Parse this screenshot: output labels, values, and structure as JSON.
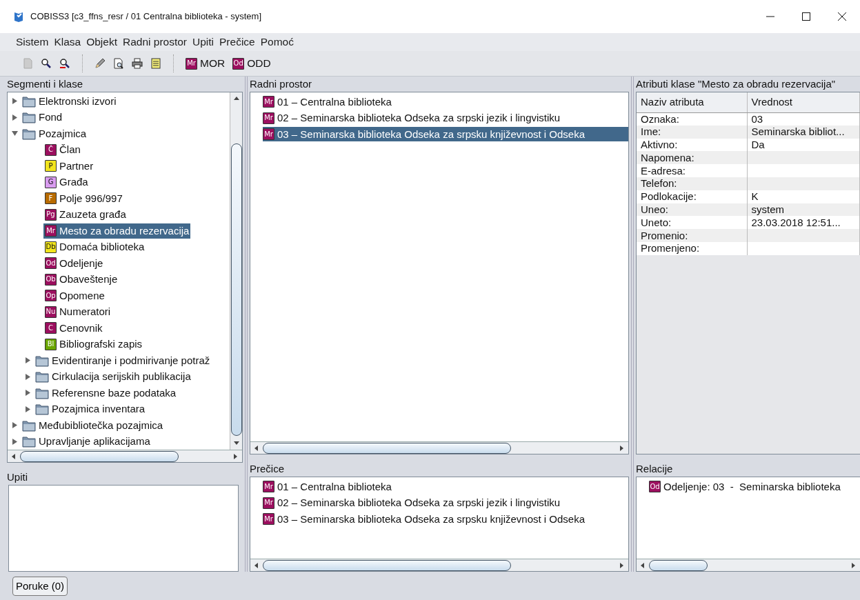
{
  "window": {
    "title": "COBISS3 [c3_ffns_resr / 01 Centralna biblioteka - system]"
  },
  "menu": [
    "Sistem",
    "Klasa",
    "Objekt",
    "Radni prostor",
    "Upiti",
    "Prečice",
    "Pomoć"
  ],
  "toolbar": {
    "buttons": [
      {
        "label": "MOR",
        "badge": "Mr",
        "color": "#9c0f5f"
      },
      {
        "label": "ODD",
        "badge": "Od",
        "color": "#9c0f5f"
      }
    ]
  },
  "segments": {
    "title": "Segmenti i klase",
    "tree": [
      {
        "kind": "folder",
        "label": "Elektronski izvori",
        "expanded": false,
        "selected": false
      },
      {
        "kind": "folder",
        "label": "Fond",
        "expanded": false,
        "selected": false
      },
      {
        "kind": "folder",
        "label": "Pozajmica",
        "expanded": true,
        "selected": false,
        "children": [
          {
            "kind": "class",
            "badge": "Č",
            "color": "#9c0f5f",
            "label": "Član",
            "selected": false
          },
          {
            "kind": "class",
            "badge": "P",
            "color": "#f2e51d",
            "label": "Partner",
            "selected": false
          },
          {
            "kind": "class",
            "badge": "G",
            "color": "#d99cf0",
            "label": "Građa",
            "selected": false
          },
          {
            "kind": "class",
            "badge": "F",
            "color": "#b86b00",
            "label": "Polje 996/997",
            "selected": false
          },
          {
            "kind": "class",
            "badge": "Pg",
            "color": "#9c0f5f",
            "label": "Zauzeta građa",
            "selected": false
          },
          {
            "kind": "class",
            "badge": "Mr",
            "color": "#9c0f5f",
            "label": "Mesto za obradu rezervacija",
            "selected": true
          },
          {
            "kind": "class",
            "badge": "Db",
            "color": "#f2e51d",
            "label": "Domaća biblioteka",
            "selected": false
          },
          {
            "kind": "class",
            "badge": "Od",
            "color": "#9c0f5f",
            "label": "Odeljenje",
            "selected": false
          },
          {
            "kind": "class",
            "badge": "Ob",
            "color": "#9c0f5f",
            "label": "Obaveštenje",
            "selected": false
          },
          {
            "kind": "class",
            "badge": "Op",
            "color": "#9c0f5f",
            "label": "Opomene",
            "selected": false
          },
          {
            "kind": "class",
            "badge": "Nu",
            "color": "#9c0f5f",
            "label": "Numeratori",
            "selected": false
          },
          {
            "kind": "class",
            "badge": "C",
            "color": "#9c0f5f",
            "label": "Cenovnik",
            "selected": false
          },
          {
            "kind": "class",
            "badge": "Bl",
            "color": "#6aa600",
            "label": "Bibliografski zapis",
            "selected": false
          },
          {
            "kind": "folder",
            "label": "Evidentiranje i podmirivanje potraž",
            "expanded": false,
            "selected": false
          },
          {
            "kind": "folder",
            "label": "Cirkulacija serijskih publikacija",
            "expanded": false,
            "selected": false
          },
          {
            "kind": "folder",
            "label": "Referensne baze podataka",
            "expanded": false,
            "selected": false
          },
          {
            "kind": "folder",
            "label": "Pozajmica inventara",
            "expanded": false,
            "selected": false
          }
        ]
      },
      {
        "kind": "folder",
        "label": "Međubibliotečka pozajmica",
        "expanded": false,
        "selected": false
      },
      {
        "kind": "folder",
        "label": "Upravljanje aplikacijama",
        "expanded": false,
        "selected": false
      }
    ]
  },
  "queries": {
    "title": "Upiti"
  },
  "workspace": {
    "title": "Radni prostor",
    "items": [
      {
        "badge": "Mr",
        "color": "#9c0f5f",
        "text": "01 – Centralna biblioteka",
        "selected": false
      },
      {
        "badge": "Mr",
        "color": "#9c0f5f",
        "text": "02 – Seminarska biblioteka Odseka za srpski jezik i lingvistiku",
        "selected": false
      },
      {
        "badge": "Mr",
        "color": "#9c0f5f",
        "text": "03 – Seminarska biblioteka Odseka za srpsku književnost i Odseka",
        "selected": true
      }
    ]
  },
  "shortcuts": {
    "title": "Prečice",
    "items": [
      {
        "badge": "Mr",
        "color": "#9c0f5f",
        "text": "01 – Centralna biblioteka"
      },
      {
        "badge": "Mr",
        "color": "#9c0f5f",
        "text": "02 – Seminarska biblioteka Odseka za srpski jezik i lingvistiku"
      },
      {
        "badge": "Mr",
        "color": "#9c0f5f",
        "text": "03 – Seminarska biblioteka Odseka za srpsku književnost i Odseka"
      }
    ]
  },
  "attributes": {
    "title": "Atributi klase \"Mesto za obradu rezervacija\"",
    "columns": [
      "Naziv atributa",
      "Vrednost"
    ],
    "rows": [
      {
        "name": "Oznaka:",
        "value": "03"
      },
      {
        "name": "Ime:",
        "value": "Seminarska bibliot..."
      },
      {
        "name": "Aktivno:",
        "value": "Da"
      },
      {
        "name": "Napomena:"
      },
      {
        "name": "E-adresa:"
      },
      {
        "name": "Telefon:"
      },
      {
        "name": "Podlokacije:",
        "value": "K"
      },
      {
        "name": "Uneo:",
        "value": "system"
      },
      {
        "name": "Uneto:",
        "value": "23.03.2018 12:51..."
      },
      {
        "name": "Promenio:"
      },
      {
        "name": "Promenjeno:"
      }
    ]
  },
  "relations": {
    "title": "Relacije",
    "items": [
      {
        "badge": "Od",
        "color": "#9c0f5f",
        "text": "Odeljenje: 03  -  Seminarska biblioteka"
      }
    ]
  },
  "status_bar": {
    "button": "Poruke (0)"
  }
}
